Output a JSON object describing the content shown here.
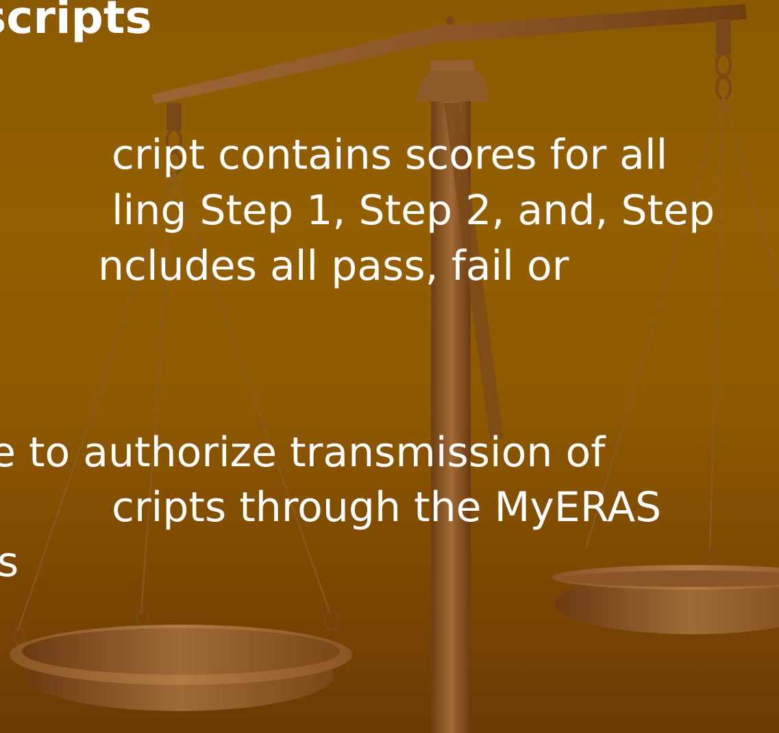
{
  "slide": {
    "title": "scripts",
    "lines": [
      "cript contains scores for all",
      "ling Step 1, Step 2, and, Step",
      "ncludes all pass, fail or",
      "e to authorize transmission of",
      "cripts through the MyERAS",
      "s"
    ]
  },
  "colors": {
    "background": "#935f00",
    "background_dark": "#6b3a05",
    "text": "#ffffff",
    "scale_bronze": "#7a4a1c",
    "scale_light": "#9a6634"
  },
  "background_image": "scales-of-justice"
}
